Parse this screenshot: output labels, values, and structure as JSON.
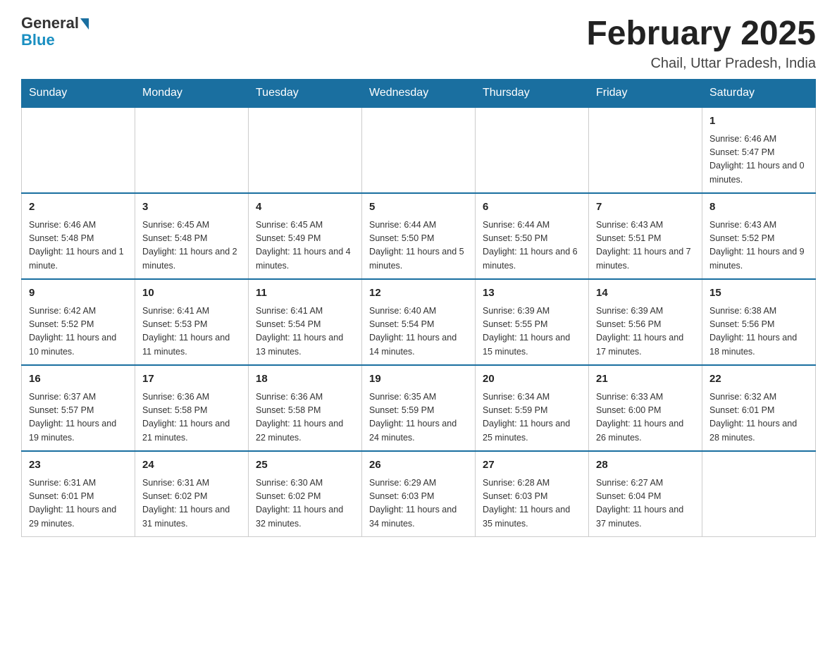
{
  "logo": {
    "general": "General",
    "blue": "Blue"
  },
  "header": {
    "month_year": "February 2025",
    "location": "Chail, Uttar Pradesh, India"
  },
  "days_of_week": [
    "Sunday",
    "Monday",
    "Tuesday",
    "Wednesday",
    "Thursday",
    "Friday",
    "Saturday"
  ],
  "weeks": [
    [
      {
        "day": "",
        "info": ""
      },
      {
        "day": "",
        "info": ""
      },
      {
        "day": "",
        "info": ""
      },
      {
        "day": "",
        "info": ""
      },
      {
        "day": "",
        "info": ""
      },
      {
        "day": "",
        "info": ""
      },
      {
        "day": "1",
        "info": "Sunrise: 6:46 AM\nSunset: 5:47 PM\nDaylight: 11 hours and 0 minutes."
      }
    ],
    [
      {
        "day": "2",
        "info": "Sunrise: 6:46 AM\nSunset: 5:48 PM\nDaylight: 11 hours and 1 minute."
      },
      {
        "day": "3",
        "info": "Sunrise: 6:45 AM\nSunset: 5:48 PM\nDaylight: 11 hours and 2 minutes."
      },
      {
        "day": "4",
        "info": "Sunrise: 6:45 AM\nSunset: 5:49 PM\nDaylight: 11 hours and 4 minutes."
      },
      {
        "day": "5",
        "info": "Sunrise: 6:44 AM\nSunset: 5:50 PM\nDaylight: 11 hours and 5 minutes."
      },
      {
        "day": "6",
        "info": "Sunrise: 6:44 AM\nSunset: 5:50 PM\nDaylight: 11 hours and 6 minutes."
      },
      {
        "day": "7",
        "info": "Sunrise: 6:43 AM\nSunset: 5:51 PM\nDaylight: 11 hours and 7 minutes."
      },
      {
        "day": "8",
        "info": "Sunrise: 6:43 AM\nSunset: 5:52 PM\nDaylight: 11 hours and 9 minutes."
      }
    ],
    [
      {
        "day": "9",
        "info": "Sunrise: 6:42 AM\nSunset: 5:52 PM\nDaylight: 11 hours and 10 minutes."
      },
      {
        "day": "10",
        "info": "Sunrise: 6:41 AM\nSunset: 5:53 PM\nDaylight: 11 hours and 11 minutes."
      },
      {
        "day": "11",
        "info": "Sunrise: 6:41 AM\nSunset: 5:54 PM\nDaylight: 11 hours and 13 minutes."
      },
      {
        "day": "12",
        "info": "Sunrise: 6:40 AM\nSunset: 5:54 PM\nDaylight: 11 hours and 14 minutes."
      },
      {
        "day": "13",
        "info": "Sunrise: 6:39 AM\nSunset: 5:55 PM\nDaylight: 11 hours and 15 minutes."
      },
      {
        "day": "14",
        "info": "Sunrise: 6:39 AM\nSunset: 5:56 PM\nDaylight: 11 hours and 17 minutes."
      },
      {
        "day": "15",
        "info": "Sunrise: 6:38 AM\nSunset: 5:56 PM\nDaylight: 11 hours and 18 minutes."
      }
    ],
    [
      {
        "day": "16",
        "info": "Sunrise: 6:37 AM\nSunset: 5:57 PM\nDaylight: 11 hours and 19 minutes."
      },
      {
        "day": "17",
        "info": "Sunrise: 6:36 AM\nSunset: 5:58 PM\nDaylight: 11 hours and 21 minutes."
      },
      {
        "day": "18",
        "info": "Sunrise: 6:36 AM\nSunset: 5:58 PM\nDaylight: 11 hours and 22 minutes."
      },
      {
        "day": "19",
        "info": "Sunrise: 6:35 AM\nSunset: 5:59 PM\nDaylight: 11 hours and 24 minutes."
      },
      {
        "day": "20",
        "info": "Sunrise: 6:34 AM\nSunset: 5:59 PM\nDaylight: 11 hours and 25 minutes."
      },
      {
        "day": "21",
        "info": "Sunrise: 6:33 AM\nSunset: 6:00 PM\nDaylight: 11 hours and 26 minutes."
      },
      {
        "day": "22",
        "info": "Sunrise: 6:32 AM\nSunset: 6:01 PM\nDaylight: 11 hours and 28 minutes."
      }
    ],
    [
      {
        "day": "23",
        "info": "Sunrise: 6:31 AM\nSunset: 6:01 PM\nDaylight: 11 hours and 29 minutes."
      },
      {
        "day": "24",
        "info": "Sunrise: 6:31 AM\nSunset: 6:02 PM\nDaylight: 11 hours and 31 minutes."
      },
      {
        "day": "25",
        "info": "Sunrise: 6:30 AM\nSunset: 6:02 PM\nDaylight: 11 hours and 32 minutes."
      },
      {
        "day": "26",
        "info": "Sunrise: 6:29 AM\nSunset: 6:03 PM\nDaylight: 11 hours and 34 minutes."
      },
      {
        "day": "27",
        "info": "Sunrise: 6:28 AM\nSunset: 6:03 PM\nDaylight: 11 hours and 35 minutes."
      },
      {
        "day": "28",
        "info": "Sunrise: 6:27 AM\nSunset: 6:04 PM\nDaylight: 11 hours and 37 minutes."
      },
      {
        "day": "",
        "info": ""
      }
    ]
  ]
}
